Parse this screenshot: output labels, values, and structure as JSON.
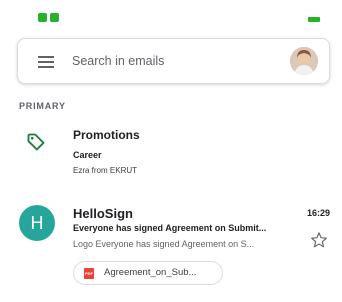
{
  "colors": {
    "accent_green": "#27b02a",
    "avatar_teal": "#26a69a",
    "promo_tag_green": "#188038",
    "pdf_red": "#ea4335"
  },
  "status_bar": {
    "icons": [
      "notification-icon",
      "notification-icon"
    ],
    "battery_icon": "battery-icon"
  },
  "search": {
    "placeholder": "Search in emails",
    "menu_icon": "menu-icon",
    "avatar_icon": "user-avatar"
  },
  "section": {
    "label": "PRIMARY"
  },
  "promotions": {
    "icon": "tag-icon",
    "title": "Promotions",
    "subject": "Career",
    "from": "Ezra from EKRUT"
  },
  "email": {
    "avatar_letter": "H",
    "sender": "HelloSign",
    "time": "16:29",
    "subject": "Everyone has signed Agreement on Submit...",
    "snippet": "Logo Everyone has signed Agreement on S...",
    "attachment": {
      "icon": "pdf-icon",
      "name": "Agreement_on_Sub..."
    },
    "star_icon": "star-icon"
  }
}
